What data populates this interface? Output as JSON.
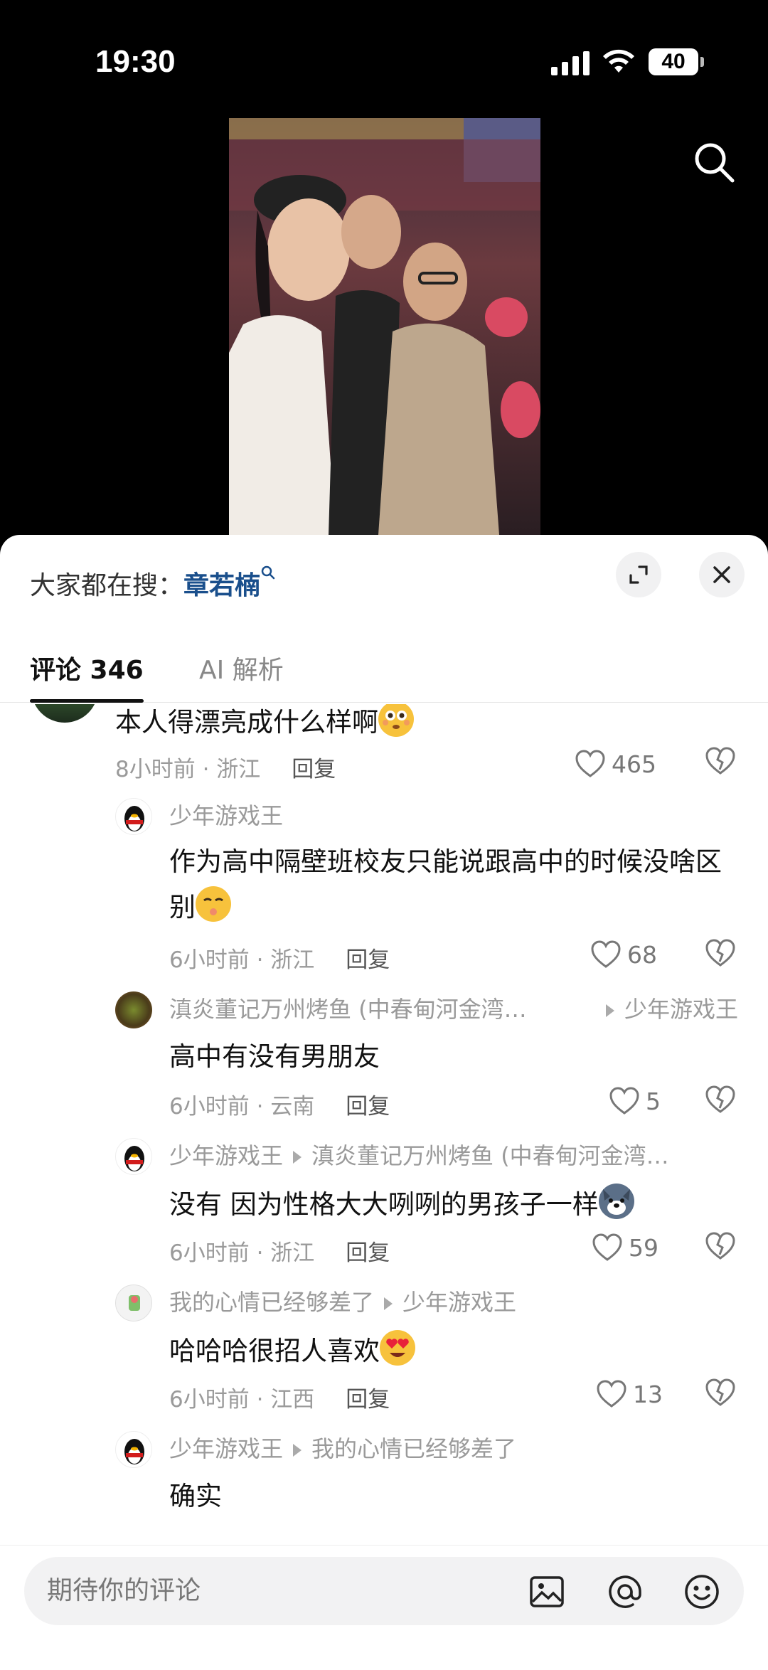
{
  "status": {
    "time": "19:30",
    "battery": "40"
  },
  "sheet": {
    "hot_search_prefix": "大家都在搜：",
    "hot_search_keyword": "章若楠",
    "tabs": {
      "comments": "评论 346",
      "ai": "AI 解析"
    }
  },
  "comments": [
    {
      "text": "本人得漂亮成什么样啊",
      "emoji": "flushed-face",
      "meta": "8小时前 · 浙江",
      "reply": "回复",
      "likes": "465"
    },
    {
      "user": "少年游戏王",
      "text": "作为高中隔壁班校友只能说跟高中的时候没啥区别",
      "emoji": "shushing-face",
      "meta": "6小时前 · 浙江",
      "reply": "回复",
      "likes": "68"
    },
    {
      "user": "滇炎董记万州烤鱼 (中春甸河金湾…",
      "reply_to": "少年游戏王",
      "text": "高中有没有男朋友",
      "meta": "6小时前 · 云南",
      "reply": "回复",
      "likes": "5"
    },
    {
      "user": "少年游戏王",
      "reply_to": "滇炎董记万州烤鱼 (中春甸河金湾…",
      "text": "没有 因为性格大大咧咧的男孩子一样",
      "emoji": "dog-face",
      "meta": "6小时前 · 浙江",
      "reply": "回复",
      "likes": "59"
    },
    {
      "user": "我的心情已经够差了",
      "reply_to": "少年游戏王",
      "text": "哈哈哈很招人喜欢",
      "emoji": "heart-eyes-face",
      "meta": "6小时前 · 江西",
      "reply": "回复",
      "likes": "13"
    },
    {
      "user": "少年游戏王",
      "reply_to": "我的心情已经够差了",
      "text": "确实"
    }
  ],
  "input": {
    "placeholder": "期待你的评论"
  },
  "colors": {
    "accent_link": "#1a4f8c",
    "sheet_bg": "#ffffff",
    "muted": "#9a9a9a"
  },
  "icons": [
    "search-icon",
    "expand-icon",
    "close-icon",
    "heart-icon",
    "broken-heart-icon",
    "image-icon",
    "at-icon",
    "emoji-icon"
  ]
}
